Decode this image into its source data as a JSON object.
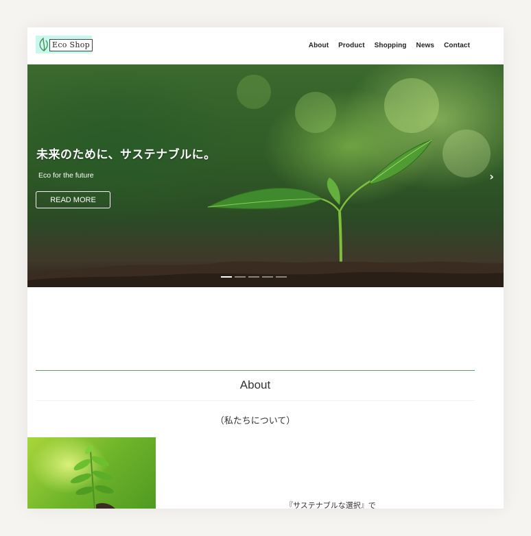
{
  "header": {
    "logo_text": "Eco Shop",
    "nav": [
      "About",
      "Product",
      "Shopping",
      "News",
      "Contact"
    ]
  },
  "hero": {
    "title": "未来のために、サステナブルに。",
    "subtitle": "Eco for the future",
    "button_label": "READ MORE",
    "next_arrow": "›",
    "slide_count": 5,
    "active_slide": 1
  },
  "about": {
    "title": "About",
    "subtitle": "（私たちについて）",
    "text": "『サステナブルな選択』で"
  },
  "colors": {
    "accent": "#5a9e72",
    "logo_bg": "#c8f7ee"
  }
}
